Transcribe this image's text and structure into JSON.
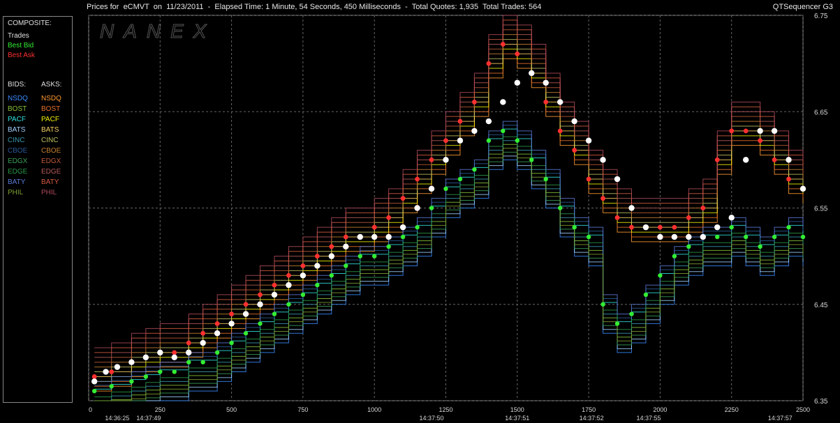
{
  "header": {
    "title": "Prices for  eCMVT  on  11/23/2011  -  Elapsed Time: 1 Minute, 54 Seconds, 450 Milliseconds  -  Total Quotes: 1,935  Total Trades: 564",
    "app_name": "QTSequencer G3"
  },
  "legend": {
    "composite_label": "COMPOSITE:",
    "composite_items": [
      {
        "label": "Trades",
        "color": "#ffffff"
      },
      {
        "label": "Best Bid",
        "color": "#33ee33"
      },
      {
        "label": "Best Ask",
        "color": "#ff3030"
      }
    ],
    "bids_label": "BIDS:",
    "asks_label": "ASKS:",
    "exchanges": [
      {
        "bid": "NSDQ",
        "ask": "NSDQ",
        "bid_color": "#3a8cff",
        "ask_color": "#ff9a30"
      },
      {
        "bid": "BOST",
        "ask": "BOST",
        "bid_color": "#8ac43a",
        "ask_color": "#e8702a"
      },
      {
        "bid": "PACF",
        "ask": "PACF",
        "bid_color": "#30e0e0",
        "ask_color": "#f0f000"
      },
      {
        "bid": "BATS",
        "ask": "BATS",
        "bid_color": "#a0d0ff",
        "ask_color": "#f8d060"
      },
      {
        "bid": "CINC",
        "ask": "CINC",
        "bid_color": "#3a9ab0",
        "ask_color": "#c0c060"
      },
      {
        "bid": "CBOE",
        "ask": "CBOE",
        "bid_color": "#2a5a9a",
        "ask_color": "#c88030"
      },
      {
        "bid": "EDGX",
        "ask": "EDGX",
        "bid_color": "#3aa05a",
        "ask_color": "#c05a3a"
      },
      {
        "bid": "EDGE",
        "ask": "EDGE",
        "bid_color": "#2a9a4a",
        "ask_color": "#b85a5a"
      },
      {
        "bid": "BATY",
        "ask": "BATY",
        "bid_color": "#5a7ad8",
        "ask_color": "#d85a40"
      },
      {
        "bid": "PHIL",
        "ask": "PHIL",
        "bid_color": "#80a030",
        "ask_color": "#b04a5a"
      }
    ]
  },
  "watermark": "NANEX",
  "chart_data": {
    "type": "scatter",
    "title": "",
    "xlabel": "",
    "ylabel": "",
    "xlim": [
      0,
      2500
    ],
    "ylim": [
      6.35,
      6.75
    ],
    "x_ticks": [
      0,
      250,
      500,
      750,
      1000,
      1250,
      1500,
      1750,
      2000,
      2250,
      2500
    ],
    "x_tick_labels": [
      "0",
      "250",
      "500",
      "750",
      "1000",
      "1250",
      "1500",
      "1750",
      "2000",
      "2250",
      "2500"
    ],
    "time_labels": [
      {
        "x": 100,
        "label": "14:36:25"
      },
      {
        "x": 210,
        "label": "14:37:49"
      },
      {
        "x": 1200,
        "label": "14:37:50"
      },
      {
        "x": 1500,
        "label": "14:37:51"
      },
      {
        "x": 1760,
        "label": "14:37:52"
      },
      {
        "x": 1960,
        "label": "14:37:55"
      },
      {
        "x": 2420,
        "label": "14:37:57"
      }
    ],
    "y_ticks": [
      6.35,
      6.45,
      6.55,
      6.65,
      6.75
    ],
    "y_tick_labels": [
      "6.35",
      "6.45",
      "6.55",
      "6.65",
      "6.75"
    ],
    "grid": true,
    "legend_position": "left",
    "series": [
      {
        "name": "Trades",
        "color": "#ffffff",
        "points": [
          [
            20,
            6.37
          ],
          [
            60,
            6.38
          ],
          [
            100,
            6.385
          ],
          [
            150,
            6.39
          ],
          [
            200,
            6.395
          ],
          [
            250,
            6.4
          ],
          [
            300,
            6.395
          ],
          [
            350,
            6.4
          ],
          [
            400,
            6.41
          ],
          [
            450,
            6.42
          ],
          [
            500,
            6.43
          ],
          [
            550,
            6.44
          ],
          [
            600,
            6.45
          ],
          [
            650,
            6.46
          ],
          [
            700,
            6.47
          ],
          [
            750,
            6.48
          ],
          [
            800,
            6.49
          ],
          [
            850,
            6.5
          ],
          [
            900,
            6.51
          ],
          [
            950,
            6.52
          ],
          [
            1000,
            6.52
          ],
          [
            1050,
            6.52
          ],
          [
            1100,
            6.53
          ],
          [
            1150,
            6.55
          ],
          [
            1200,
            6.57
          ],
          [
            1250,
            6.6
          ],
          [
            1300,
            6.62
          ],
          [
            1350,
            6.63
          ],
          [
            1400,
            6.64
          ],
          [
            1450,
            6.66
          ],
          [
            1500,
            6.68
          ],
          [
            1550,
            6.69
          ],
          [
            1600,
            6.68
          ],
          [
            1650,
            6.66
          ],
          [
            1700,
            6.64
          ],
          [
            1750,
            6.62
          ],
          [
            1800,
            6.6
          ],
          [
            1850,
            6.58
          ],
          [
            1900,
            6.55
          ],
          [
            1950,
            6.53
          ],
          [
            2000,
            6.52
          ],
          [
            2050,
            6.52
          ],
          [
            2100,
            6.52
          ],
          [
            2150,
            6.52
          ],
          [
            2200,
            6.53
          ],
          [
            2250,
            6.54
          ],
          [
            2300,
            6.6
          ],
          [
            2350,
            6.63
          ],
          [
            2400,
            6.63
          ],
          [
            2450,
            6.6
          ],
          [
            2500,
            6.57
          ]
        ]
      },
      {
        "name": "Best Bid",
        "color": "#33ee33",
        "points": [
          [
            20,
            6.36
          ],
          [
            80,
            6.365
          ],
          [
            150,
            6.37
          ],
          [
            200,
            6.375
          ],
          [
            250,
            6.38
          ],
          [
            300,
            6.38
          ],
          [
            350,
            6.39
          ],
          [
            400,
            6.39
          ],
          [
            450,
            6.4
          ],
          [
            500,
            6.41
          ],
          [
            550,
            6.42
          ],
          [
            600,
            6.43
          ],
          [
            650,
            6.44
          ],
          [
            700,
            6.45
          ],
          [
            750,
            6.46
          ],
          [
            800,
            6.47
          ],
          [
            850,
            6.48
          ],
          [
            900,
            6.49
          ],
          [
            950,
            6.5
          ],
          [
            1000,
            6.5
          ],
          [
            1050,
            6.51
          ],
          [
            1100,
            6.52
          ],
          [
            1150,
            6.53
          ],
          [
            1200,
            6.55
          ],
          [
            1250,
            6.57
          ],
          [
            1300,
            6.58
          ],
          [
            1350,
            6.59
          ],
          [
            1400,
            6.62
          ],
          [
            1450,
            6.63
          ],
          [
            1500,
            6.62
          ],
          [
            1550,
            6.6
          ],
          [
            1600,
            6.58
          ],
          [
            1650,
            6.55
          ],
          [
            1700,
            6.53
          ],
          [
            1750,
            6.52
          ],
          [
            1800,
            6.45
          ],
          [
            1850,
            6.43
          ],
          [
            1900,
            6.44
          ],
          [
            1950,
            6.46
          ],
          [
            2000,
            6.48
          ],
          [
            2050,
            6.5
          ],
          [
            2100,
            6.51
          ],
          [
            2150,
            6.52
          ],
          [
            2200,
            6.52
          ],
          [
            2250,
            6.53
          ],
          [
            2300,
            6.52
          ],
          [
            2350,
            6.51
          ],
          [
            2400,
            6.52
          ],
          [
            2450,
            6.53
          ],
          [
            2500,
            6.52
          ]
        ]
      },
      {
        "name": "Best Ask",
        "color": "#ff3030",
        "points": [
          [
            20,
            6.375
          ],
          [
            80,
            6.38
          ],
          [
            150,
            6.39
          ],
          [
            200,
            6.395
          ],
          [
            250,
            6.4
          ],
          [
            300,
            6.4
          ],
          [
            350,
            6.41
          ],
          [
            400,
            6.42
          ],
          [
            450,
            6.43
          ],
          [
            500,
            6.44
          ],
          [
            550,
            6.45
          ],
          [
            600,
            6.46
          ],
          [
            650,
            6.47
          ],
          [
            700,
            6.48
          ],
          [
            750,
            6.49
          ],
          [
            800,
            6.5
          ],
          [
            850,
            6.51
          ],
          [
            900,
            6.52
          ],
          [
            950,
            6.52
          ],
          [
            1000,
            6.53
          ],
          [
            1050,
            6.54
          ],
          [
            1100,
            6.56
          ],
          [
            1150,
            6.58
          ],
          [
            1200,
            6.6
          ],
          [
            1250,
            6.62
          ],
          [
            1300,
            6.64
          ],
          [
            1350,
            6.66
          ],
          [
            1400,
            6.7
          ],
          [
            1450,
            6.72
          ],
          [
            1500,
            6.71
          ],
          [
            1550,
            6.69
          ],
          [
            1600,
            6.66
          ],
          [
            1650,
            6.63
          ],
          [
            1700,
            6.61
          ],
          [
            1750,
            6.58
          ],
          [
            1800,
            6.56
          ],
          [
            1850,
            6.54
          ],
          [
            1900,
            6.53
          ],
          [
            1950,
            6.53
          ],
          [
            2000,
            6.53
          ],
          [
            2050,
            6.53
          ],
          [
            2100,
            6.54
          ],
          [
            2150,
            6.55
          ],
          [
            2200,
            6.6
          ],
          [
            2250,
            6.63
          ],
          [
            2300,
            6.63
          ],
          [
            2350,
            6.62
          ],
          [
            2400,
            6.6
          ],
          [
            2450,
            6.58
          ],
          [
            2500,
            6.57
          ]
        ]
      }
    ]
  }
}
